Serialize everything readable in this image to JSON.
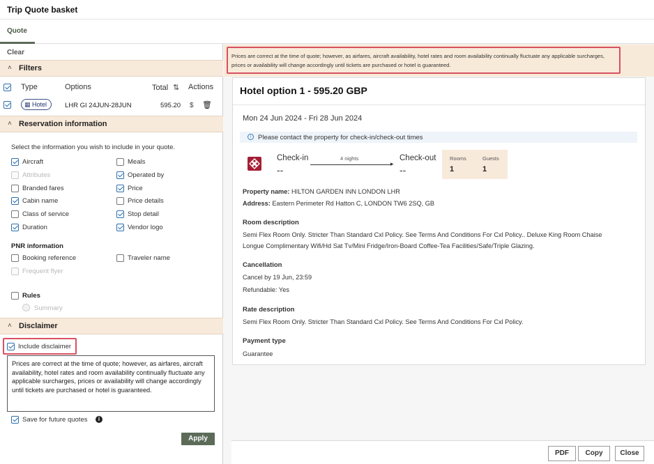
{
  "window": {
    "title": "Trip Quote basket"
  },
  "tabs": [
    {
      "label": "Quote"
    }
  ],
  "left": {
    "clear_label": "Clear",
    "filters": {
      "title": "Filters",
      "headers": {
        "type": "Type",
        "options": "Options",
        "total": "Total",
        "actions": "Actions"
      },
      "row": {
        "type": "Hotel",
        "options": "LHR GI 24JUN-28JUN",
        "total": "595.20",
        "currency": "$"
      }
    },
    "reservation": {
      "title": "Reservation information",
      "intro": "Select the information you wish to include in your quote.",
      "items": [
        {
          "label": "Aircraft",
          "checked": true
        },
        {
          "label": "Meals",
          "checked": false
        },
        {
          "label": "Attributes",
          "checked": false,
          "disabled": true
        },
        {
          "label": "Operated by",
          "checked": true
        },
        {
          "label": "Branded fares",
          "checked": false
        },
        {
          "label": "Price",
          "checked": true
        },
        {
          "label": "Cabin name",
          "checked": true
        },
        {
          "label": "Price details",
          "checked": false
        },
        {
          "label": "Class of service",
          "checked": false
        },
        {
          "label": "Stop detail",
          "checked": true
        },
        {
          "label": "Duration",
          "checked": true
        },
        {
          "label": "Vendor logo",
          "checked": true
        }
      ],
      "pnr_title": "PNR information",
      "pnr_items": [
        {
          "label": "Booking reference",
          "checked": false
        },
        {
          "label": "Traveler name",
          "checked": false
        },
        {
          "label": "Frequent flyer",
          "checked": false,
          "disabled": true
        }
      ],
      "rules_label": "Rules",
      "summary_label": "Summary"
    },
    "disclaimer": {
      "title": "Disclaimer",
      "include_label": "Include disclaimer",
      "include_checked": true,
      "text": "Prices are correct at the time of quote; however, as airfares, aircraft availability, hotel rates and room availability continually fluctuate any applicable surcharges, prices or availability will change accordingly until tickets are purchased or hotel is guaranteed.",
      "save_label": "Save for future quotes",
      "save_checked": true,
      "apply_label": "Apply"
    }
  },
  "preview": {
    "banner_text": "Prices are correct at the time of quote; however, as airfares, aircraft availability, hotel rates and room availability continually fluctuate any applicable surcharges, prices or availability will change accordingly until tickets are purchased or hotel is guaranteed.",
    "card_title": "Hotel option 1 - 595.20 GBP",
    "dates": "Mon 24 Jun 2024 - Fri 28 Jun 2024",
    "info_note": "Please contact the property for check-in/check-out times",
    "checkin_label": "Check-in",
    "checkin_time": "--",
    "nights": "4 nights",
    "checkout_label": "Check-out",
    "checkout_time": "--",
    "rooms_label": "Rooms",
    "rooms_value": "1",
    "guests_label": "Guests",
    "guests_value": "1",
    "property_label": "Property name:",
    "property_value": "HILTON GARDEN INN LONDON LHR",
    "address_label": "Address:",
    "address_value": "Eastern Perimeter Rd Hatton C, LONDON TW6 2SQ, GB",
    "room_desc_title": "Room description",
    "room_desc_line1": "Semi Flex Room Only. Stricter Than Standard Cxl Policy. See Terms And Conditions For Cxl Policy.. Deluxe King Room Chaise",
    "room_desc_line2": "Longue Complimentary Wifi/Hd Sat Tv/Mini Fridge/Iron-Board Coffee-Tea Facilities/Safe/Triple Glazing.",
    "cancel_title": "Cancellation",
    "cancel_by": "Cancel by 19 Jun, 23:59",
    "refundable": "Refundable: Yes",
    "rate_title": "Rate description",
    "rate_text": "Semi Flex Room Only. Stricter Than Standard Cxl Policy. See Terms And Conditions For Cxl Policy.",
    "payment_title": "Payment type",
    "payment_value": "Guarantee"
  },
  "footer": {
    "pdf_label": "PDF",
    "copy_label": "Copy",
    "close_label": "Close"
  },
  "colors": {
    "accent_green": "#5b6b58",
    "section_bg": "#f8eadb",
    "highlight_red": "#d85061",
    "link_blue": "#2c6fad"
  }
}
